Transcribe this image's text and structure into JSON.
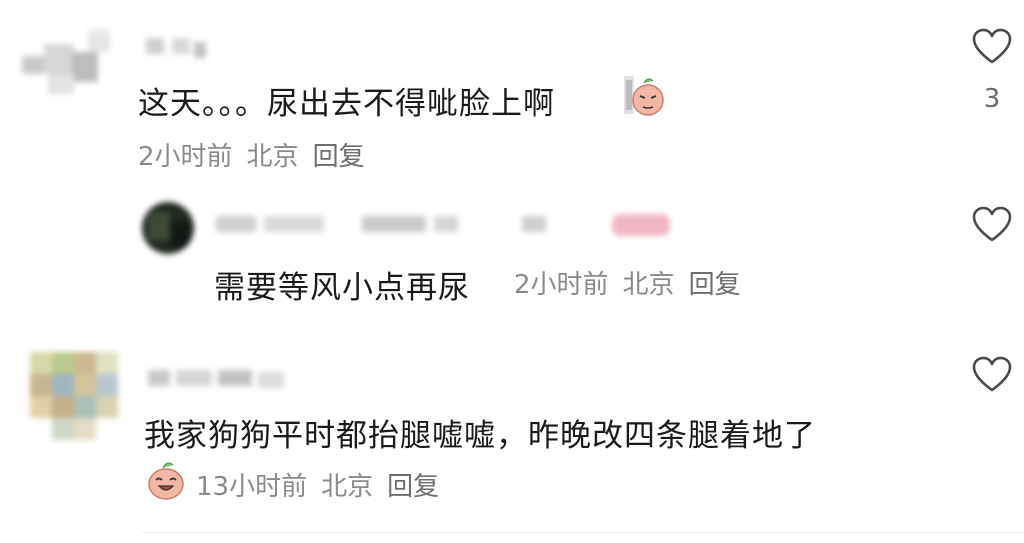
{
  "comments": [
    {
      "text": "这天。。。尿出去不得呲脸上啊",
      "time": "2小时前",
      "location": "北京",
      "reply_label": "回复",
      "likes": "3",
      "emoji_icon": "sweating-peach-emoji"
    },
    {
      "text": "需要等风小点再尿",
      "time": "2小时前",
      "location": "北京",
      "reply_label": "回复"
    },
    {
      "text": "我家狗狗平时都抬腿嘘嘘，昨晚改四条腿着地了",
      "time": "13小时前",
      "location": "北京",
      "reply_label": "回复",
      "emoji_icon": "laughing-peach-emoji"
    }
  ],
  "colors": {
    "text": "#1a1a1a",
    "meta": "#8a8a8a",
    "heart_stroke": "#4a4a4a",
    "emoji_fill": "#f4b7a6"
  }
}
